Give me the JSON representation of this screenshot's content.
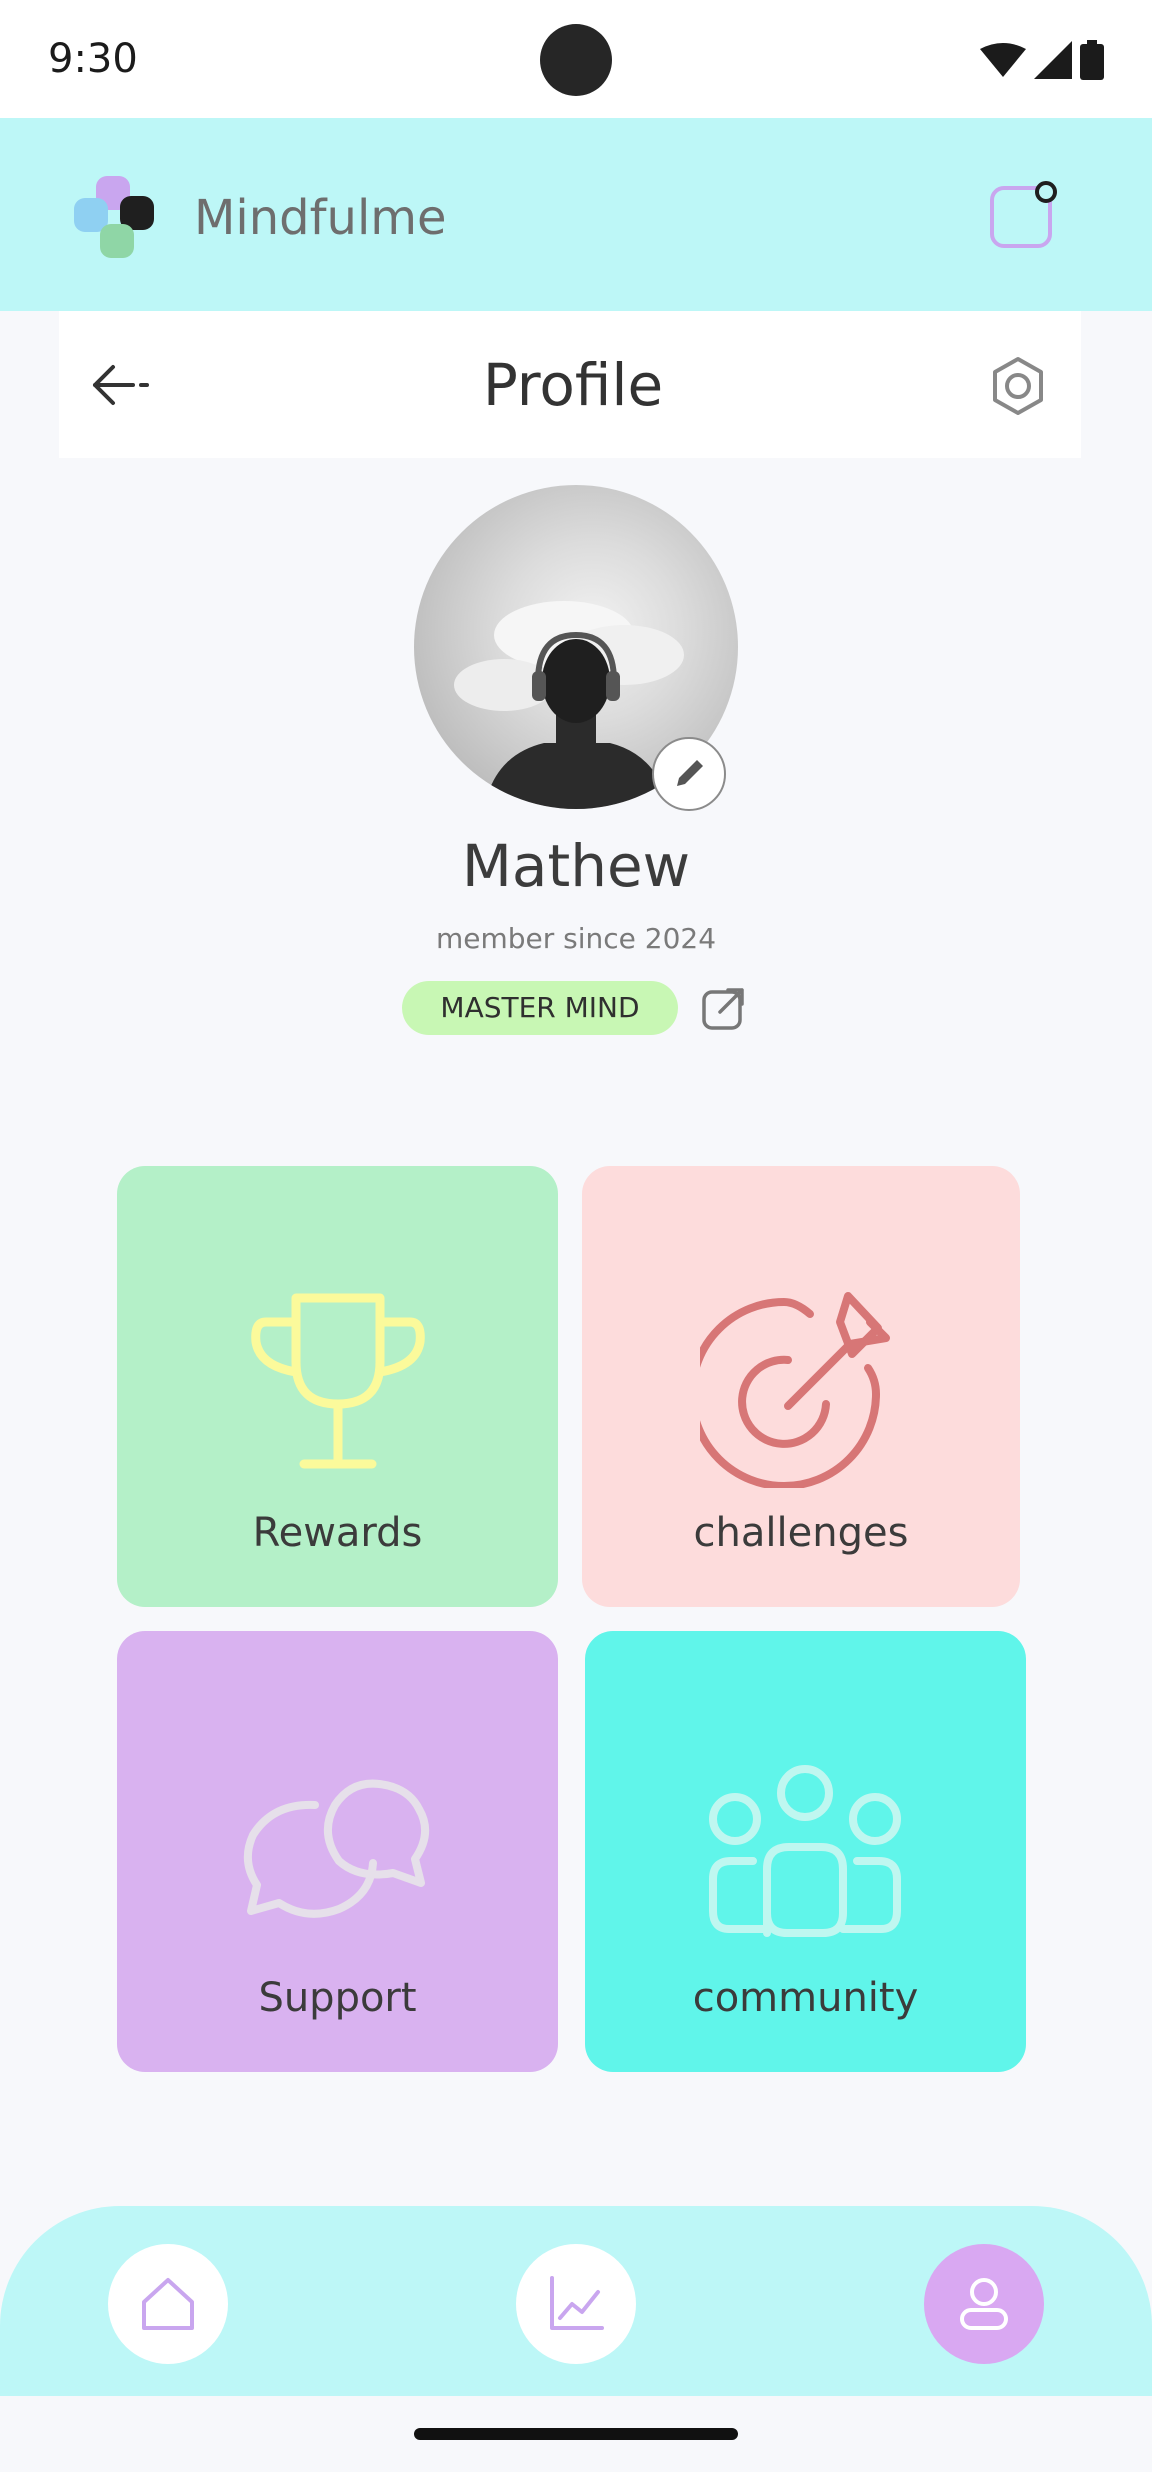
{
  "status_bar": {
    "time": "9:30"
  },
  "header": {
    "app_name": "Mindfulme"
  },
  "profile_bar": {
    "title": "Profile"
  },
  "profile": {
    "name": "Mathew",
    "member_since": "member since 2024",
    "badge": "MASTER MIND"
  },
  "tiles": [
    {
      "label": "Rewards",
      "icon": "trophy-icon",
      "color": "#b4f0c8"
    },
    {
      "label": "challenges",
      "icon": "target-icon",
      "color": "#fddcdc"
    },
    {
      "label": "Support",
      "icon": "chat-bubbles-icon",
      "color": "#d9b2f0"
    },
    {
      "label": "community",
      "icon": "people-icon",
      "color": "#60f5ea"
    }
  ],
  "bottom_nav": {
    "items": [
      {
        "icon": "home-icon",
        "active": false
      },
      {
        "icon": "chart-icon",
        "active": false
      },
      {
        "icon": "profile-icon",
        "active": true
      }
    ]
  },
  "colors": {
    "header_bg": "#bdf7f7",
    "accent_purple": "#d9a8f2",
    "badge_bg": "#c8f7b4"
  }
}
